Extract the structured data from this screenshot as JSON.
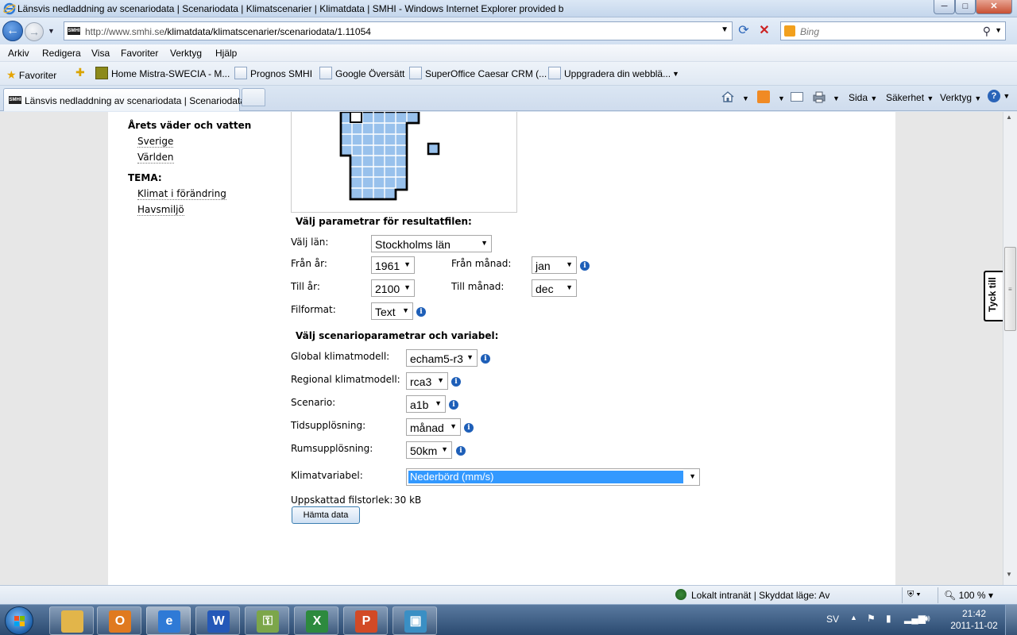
{
  "window": {
    "title": "Länsvis nedladdning av scenariodata | Scenariodata | Klimatscenarier | Klimatdata | SMHI - Windows Internet Explorer provided b",
    "min": "─",
    "max": "□",
    "close": "✕"
  },
  "address": {
    "url_host": "http://www.smhi.se",
    "url_path": "/klimatdata/klimatscenarier/scenariodata/1.11054",
    "site_icon": "SMHI"
  },
  "search": {
    "placeholder": "Bing"
  },
  "menu": [
    "Arkiv",
    "Redigera",
    "Visa",
    "Favoriter",
    "Verktyg",
    "Hjälp"
  ],
  "favorites": {
    "label": "Favoriter",
    "items": [
      "Home Mistra-SWECIA - M...",
      "Prognos  SMHI",
      "Google Översätt",
      "SuperOffice Caesar CRM (...",
      "Uppgradera din webblä..."
    ]
  },
  "tab": {
    "label": "Länsvis nedladdning av scenariodata | Scenariodata...",
    "icon": "SMHI"
  },
  "commands": {
    "page": "Sida",
    "safety": "Säkerhet",
    "tools": "Verktyg"
  },
  "leftnav": {
    "heading1": "Årets väder och vatten",
    "links1": [
      "Sverige",
      "Världen"
    ],
    "heading2": "TEMA:",
    "links2": [
      "Klimat i förändring",
      "Havsmiljö"
    ]
  },
  "form": {
    "section1_title": "Välj parametrar för resultatfilen:",
    "county_label": "Välj län:",
    "county_value": "Stockholms län",
    "from_year_label": "Från år:",
    "from_year_value": "1961",
    "from_month_label": "Från månad:",
    "from_month_value": "jan",
    "to_year_label": "Till år:",
    "to_year_value": "2100",
    "to_month_label": "Till månad:",
    "to_month_value": "dec",
    "format_label": "Filformat:",
    "format_value": "Text",
    "section2_title": "Välj scenarioparametrar och variabel:",
    "gcm_label": "Global klimatmodell:",
    "gcm_value": "echam5-r3",
    "rcm_label": "Regional klimatmodell:",
    "rcm_value": "rca3",
    "scenario_label": "Scenario:",
    "scenario_value": "a1b",
    "time_res_label": "Tidsupplösning:",
    "time_res_value": "månad",
    "space_res_label": "Rumsupplösning:",
    "space_res_value": "50km",
    "variable_label": "Klimatvariabel:",
    "variable_value": "Nederbörd (mm/s)",
    "filesize_label": "Uppskattad filstorlek:",
    "filesize_value": "30 kB",
    "fetch_button": "Hämta data"
  },
  "feedback_tab": "Tyck till",
  "status": {
    "zone": "Lokalt intranät | Skyddat läge: Av",
    "zoom": "100 %"
  },
  "taskbar": {
    "apps": [
      {
        "name": "Utforskaren",
        "color": "#e2b54a"
      },
      {
        "name": "Outlook",
        "color": "#e07a1f"
      },
      {
        "name": "Internet Explorer",
        "color": "#2f7ad6"
      },
      {
        "name": "Word",
        "color": "#2458b8"
      },
      {
        "name": "Säkerhet",
        "color": "#7ca64a"
      },
      {
        "name": "Excel",
        "color": "#2d8a3e"
      },
      {
        "name": "PowerPoint",
        "color": "#d24a26"
      },
      {
        "name": "Fjärrskrivbord",
        "color": "#3a8fc4"
      }
    ],
    "lang": "SV",
    "time": "21:42",
    "date": "2011-11-02"
  }
}
